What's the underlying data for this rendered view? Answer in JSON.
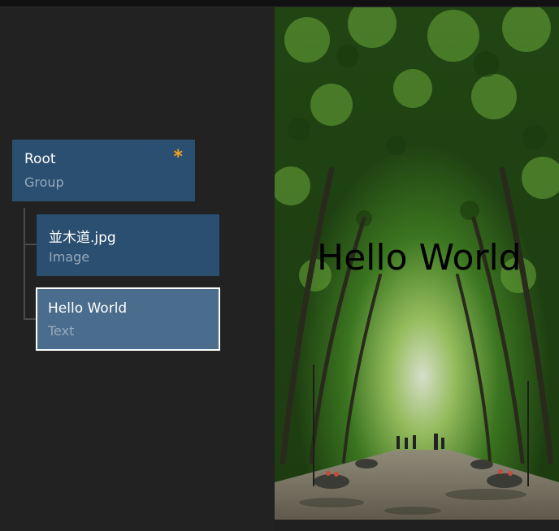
{
  "layers": [
    {
      "title": "Root",
      "subtitle": "Group",
      "modified_marker": "*"
    },
    {
      "title": "並木道.jpg",
      "subtitle": "Image"
    },
    {
      "title": "Hello World",
      "subtitle": "Text"
    }
  ],
  "canvas": {
    "overlay_text": "Hello World"
  },
  "colors": {
    "node_bg": "#2b4f70",
    "node_selected_bg": "#4b6d8d",
    "modified_marker": "#f0a21e"
  }
}
